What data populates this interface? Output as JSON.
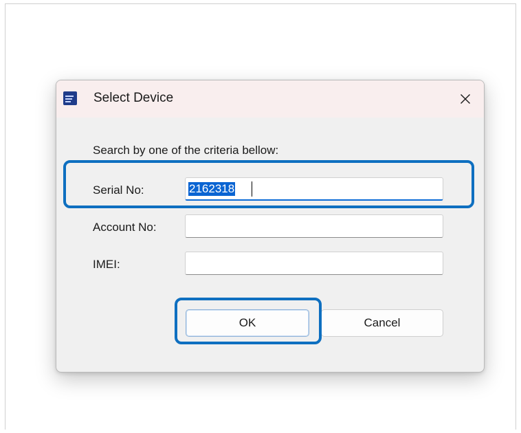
{
  "dialog": {
    "title": "Select Device",
    "app_icon": "app-logo-icon",
    "close_icon": "close-icon"
  },
  "form": {
    "instruction": "Search by one of the criteria bellow:",
    "serial_label": "Serial No:",
    "serial_value": "2162318",
    "account_label": "Account No:",
    "account_value": "",
    "imei_label": "IMEI:",
    "imei_value": ""
  },
  "buttons": {
    "ok_label": "OK",
    "cancel_label": "Cancel"
  },
  "colors": {
    "highlight": "#0e6fc0",
    "selection": "#0a64d2",
    "titlebar": "#f9eeee",
    "dialog_bg": "#f0f0f0"
  }
}
